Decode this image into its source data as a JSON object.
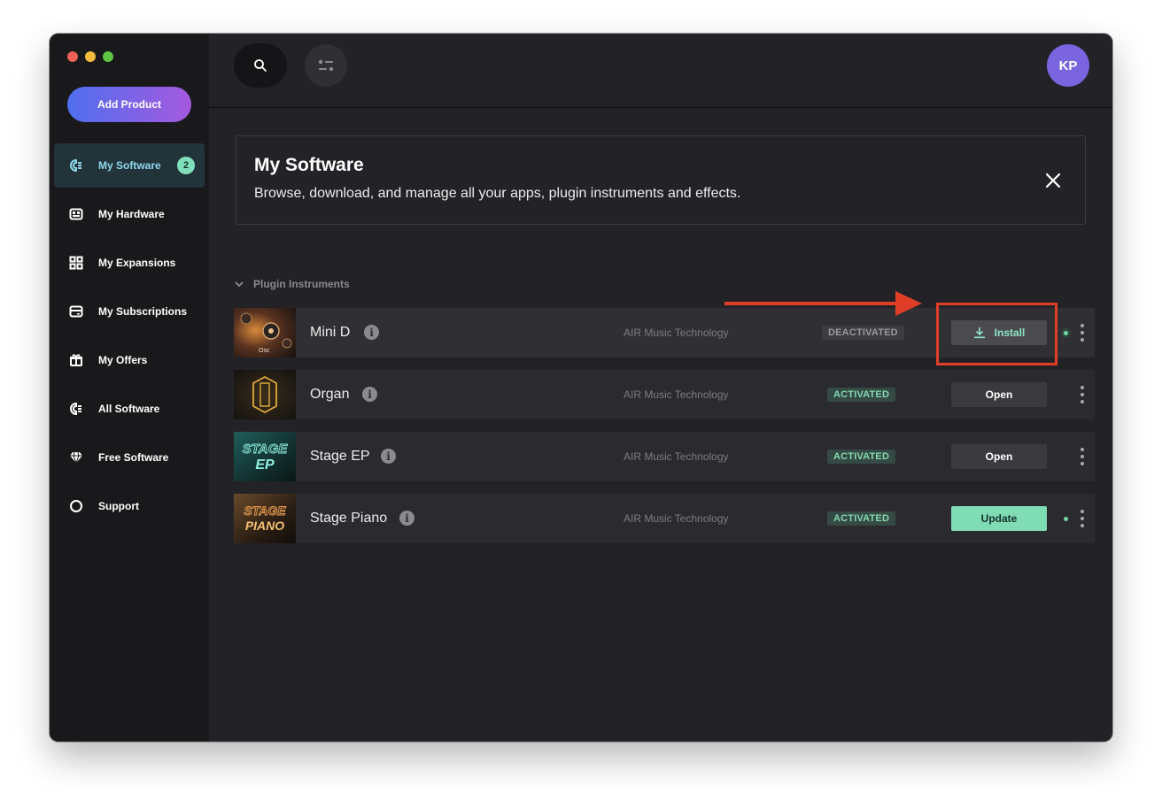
{
  "sidebar": {
    "add_product_label": "Add Product",
    "items": [
      {
        "label": "My Software",
        "icon": "software-icon",
        "badge": "2",
        "active": true
      },
      {
        "label": "My Hardware",
        "icon": "hardware-icon"
      },
      {
        "label": "My Expansions",
        "icon": "expansions-grid-icon"
      },
      {
        "label": "My Subscriptions",
        "icon": "subscriptions-icon"
      },
      {
        "label": "My Offers",
        "icon": "gift-icon"
      },
      {
        "label": "All Software",
        "icon": "software-icon"
      },
      {
        "label": "Free Software",
        "icon": "diamond-icon"
      },
      {
        "label": "Support",
        "icon": "support-circle-icon"
      }
    ]
  },
  "topbar": {
    "avatar_initials": "KP"
  },
  "banner": {
    "title": "My Software",
    "description": "Browse, download, and manage all your apps, plugin instruments and effects."
  },
  "section": {
    "label": "Plugin Instruments"
  },
  "products": [
    {
      "name": "Mini D",
      "vendor": "AIR Music Technology",
      "status": "DEACTIVATED",
      "action": "Install",
      "thumb_text": "Osc"
    },
    {
      "name": "Organ",
      "vendor": "AIR Music Technology",
      "status": "ACTIVATED",
      "action": "Open"
    },
    {
      "name": "Stage EP",
      "vendor": "AIR Music Technology",
      "status": "ACTIVATED",
      "action": "Open",
      "thumb_text_1": "STAGE",
      "thumb_text_2": "EP"
    },
    {
      "name": "Stage Piano",
      "vendor": "AIR Music Technology",
      "status": "ACTIVATED",
      "action": "Update",
      "thumb_text_1": "STAGE",
      "thumb_text_2": "PIANO"
    }
  ],
  "colors": {
    "accent_teal": "#7fdcb5",
    "sidebar_active_text": "#8fd8ec",
    "avatar": "#7a64e0",
    "annotation_red": "#e13e27"
  }
}
